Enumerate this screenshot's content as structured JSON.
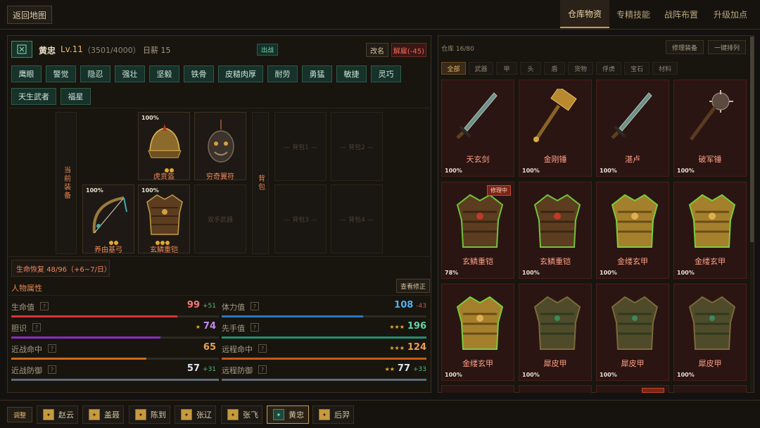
{
  "topbar": {
    "back_label": "返回地图",
    "tabs": [
      {
        "label": "仓库物资"
      },
      {
        "label": "专精技能"
      },
      {
        "label": "战阵布置"
      },
      {
        "label": "升级加点"
      }
    ]
  },
  "hero": {
    "name": "黄忠",
    "level": "Lv.11",
    "exp": "（3501/4000）",
    "salary": "日薪 15",
    "status_badge": "出战",
    "rename_label": "改名",
    "dismiss_label": "解雇(-45)",
    "traits": [
      "鹰眼",
      "警觉",
      "隐忍",
      "强壮",
      "坚毅",
      "铁骨",
      "皮糙肉厚",
      "耐劳",
      "勇猛",
      "敏捷",
      "灵巧",
      "天生武者",
      "福星"
    ]
  },
  "equipment": {
    "label_current": "当前装备",
    "label_bag": "背包",
    "helmet": {
      "name": "虎贲盔",
      "pct": "100%",
      "durability": 1.0
    },
    "amulet": {
      "name": "穷奇翼符"
    },
    "weapon": {
      "name": "养由基弓",
      "pct": "100%",
      "durability": 1.0
    },
    "armor": {
      "name": "玄鳞重铠",
      "pct": "100%",
      "durability": 1.0
    },
    "offhand_placeholder": "双手武器",
    "bags": [
      "— 背包1 —",
      "— 背包2 —",
      "— 背包3 —",
      "— 背包4 —"
    ]
  },
  "recovery": "生命恢复 48/96（+6~7/日）",
  "attributes": {
    "title": "人物属性",
    "view_label": "查看修正",
    "help": "?",
    "rows": [
      {
        "name": "生命值",
        "value": "99",
        "delta": "+51",
        "stars": "",
        "color": "#d8333a",
        "value_color": "#f07a7a",
        "delta_color": "#56b77e",
        "fill": 0.8
      },
      {
        "name": "体力值",
        "value": "108",
        "delta": "-43",
        "stars": "",
        "color": "#2a78c0",
        "value_color": "#4fb1ef",
        "delta_color": "#d34f43",
        "fill": 0.69
      },
      {
        "name": "胆识",
        "value": "74",
        "delta": "",
        "stars": "★",
        "color": "#8b2bc2",
        "value_color": "#c38af0",
        "delta_color": "",
        "fill": 0.72
      },
      {
        "name": "先手值",
        "value": "196",
        "delta": "",
        "stars": "★★★",
        "color": "#1f8f72",
        "value_color": "#66d3a9",
        "delta_color": "",
        "fill": 1.0
      },
      {
        "name": "近战命中",
        "value": "65",
        "delta": "",
        "stars": "",
        "color": "#c96a18",
        "value_color": "#e8a24a",
        "delta_color": "",
        "fill": 0.65
      },
      {
        "name": "远程命中",
        "value": "124",
        "delta": "",
        "stars": "★★★",
        "color": "#c45a17",
        "value_color": "#ef9b50",
        "delta_color": "",
        "fill": 1.0
      },
      {
        "name": "近战防御",
        "value": "57",
        "delta": "+31",
        "stars": "",
        "color": "#5e6b7a",
        "value_color": "#dfe6ee",
        "delta_color": "#56b77e",
        "fill": 1.0
      },
      {
        "name": "远程防御",
        "value": "77",
        "delta": "+33",
        "stars": "★★",
        "color": "#5e6b7a",
        "value_color": "#dfe6ee",
        "delta_color": "#56b77e",
        "fill": 1.0
      }
    ]
  },
  "warehouse": {
    "capacity": "仓库 16/80",
    "repair_label": "修理装备",
    "sort_label": "一键排列",
    "categories": [
      "全部",
      "武器",
      "甲",
      "头",
      "盾",
      "货物",
      "俘虏",
      "宝石",
      "材料"
    ],
    "repairing_label": "修理中",
    "items": [
      {
        "name": "天玄剑",
        "pct": "100%",
        "kind": "sword",
        "badge": ""
      },
      {
        "name": "金刚锤",
        "pct": "100%",
        "kind": "hammer",
        "badge": ""
      },
      {
        "name": "湛卢",
        "pct": "100%",
        "kind": "sword",
        "badge": ""
      },
      {
        "name": "破军锤",
        "pct": "100%",
        "kind": "mace",
        "badge": ""
      },
      {
        "name": "玄鳞重铠",
        "pct": "78%",
        "kind": "armor",
        "badge": "修理中"
      },
      {
        "name": "玄鳞重铠",
        "pct": "100%",
        "kind": "armor",
        "badge": ""
      },
      {
        "name": "金缕玄甲",
        "pct": "100%",
        "kind": "goldarmor",
        "badge": ""
      },
      {
        "name": "金缕玄甲",
        "pct": "100%",
        "kind": "goldarmor",
        "badge": ""
      },
      {
        "name": "金缕玄甲",
        "pct": "100%",
        "kind": "goldarmor",
        "badge": ""
      },
      {
        "name": "犀皮甲",
        "pct": "100%",
        "kind": "leather",
        "badge": ""
      },
      {
        "name": "犀皮甲",
        "pct": "100%",
        "kind": "leather",
        "badge": ""
      },
      {
        "name": "犀皮甲",
        "pct": "100%",
        "kind": "leather",
        "badge": ""
      }
    ]
  },
  "team": {
    "adjust_label": "调整",
    "heroes": [
      "赵云",
      "盖聂",
      "陈到",
      "张辽",
      "张飞",
      "黄忠",
      "后羿"
    ]
  }
}
